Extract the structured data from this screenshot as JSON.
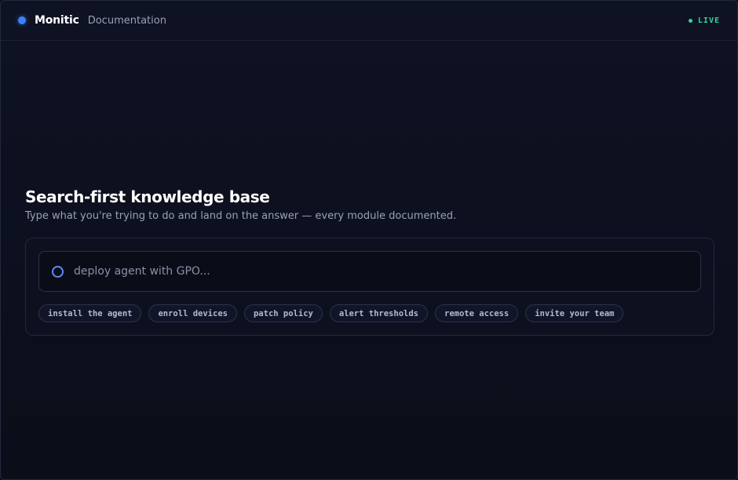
{
  "header": {
    "brand": "Monitic",
    "section": "Documentation",
    "status": "LIVE"
  },
  "hero": {
    "title": "Search-first knowledge base",
    "subtitle": "Type what you're trying to do and land on the answer — every module documented."
  },
  "search": {
    "placeholder": "deploy agent with GPO..."
  },
  "suggestions": [
    "install the agent",
    "enroll devices",
    "patch policy",
    "alert thresholds",
    "remote access",
    "invite your team"
  ],
  "colors": {
    "accent": "#3b82f6",
    "live": "#34d399",
    "background": "#0c0e1a"
  }
}
